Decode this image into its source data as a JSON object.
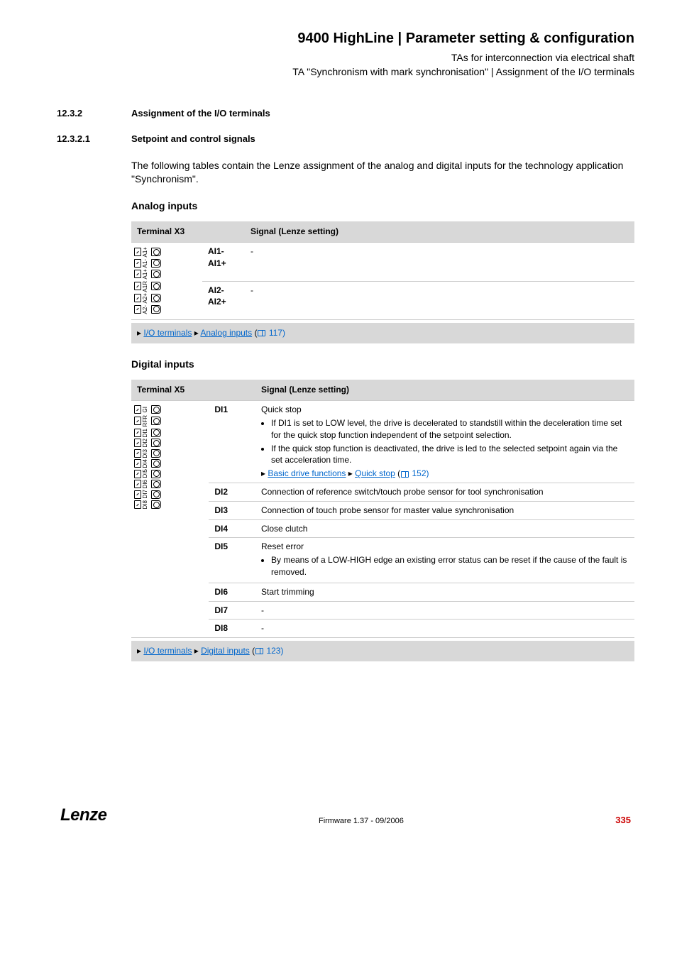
{
  "header": {
    "title": "9400 HighLine | Parameter setting & configuration",
    "sub1": "TAs for interconnection via electrical shaft",
    "sub2": "TA \"Synchronism with mark synchronisation\" | Assignment of the I/O terminals"
  },
  "section1": {
    "num": "12.3.2",
    "title": "Assignment of the I/O terminals"
  },
  "section2": {
    "num": "12.3.2.1",
    "title": "Setpoint and control signals"
  },
  "intro": "The following tables contain the Lenze assignment of the analog and digital inputs for the technology application \"Synchronism\".",
  "analog": {
    "heading": "Analog inputs",
    "col1": "Terminal X3",
    "col2": "Signal (Lenze setting)",
    "rows": [
      {
        "label_a": "AI1-",
        "label_b": "AI1+",
        "signal": "-"
      },
      {
        "label_a": "AI2-",
        "label_b": "AI2+",
        "signal": "-"
      }
    ],
    "pins": [
      "A1+",
      "A1-",
      "A1+",
      "A1R",
      "A2+",
      "A2-"
    ],
    "linkbar": {
      "pre": "▸ ",
      "link1": "I/O terminals",
      "mid": " ▸ ",
      "link2": "Analog inputs",
      "ref": " 117)"
    }
  },
  "digital": {
    "heading": "Digital inputs",
    "col1": "Terminal X5",
    "col2": "Signal (Lenze setting)",
    "pins": [
      "GI",
      "RFR",
      "DI1",
      "DI2",
      "DI3",
      "DI4",
      "DI5",
      "DI6",
      "DI7",
      "DI8"
    ],
    "rows": [
      {
        "label": "DI1",
        "title": "Quick stop",
        "bullets": [
          "If DI1 is set to LOW level, the drive is decelerated to standstill within the deceleration time set for the quick stop function independent of the setpoint selection.",
          "If the quick stop function is deactivated, the drive is led to the selected setpoint again via the set acceleration time."
        ],
        "link": {
          "pre": "▸ ",
          "l1": "Basic drive functions",
          "mid": " ▸ ",
          "l2": "Quick stop",
          "ref": " 152)"
        }
      },
      {
        "label": "DI2",
        "plain": "Connection of reference switch/touch probe sensor for tool synchronisation"
      },
      {
        "label": "DI3",
        "plain": "Connection of touch probe sensor for master value synchronisation"
      },
      {
        "label": "DI4",
        "plain": "Close clutch"
      },
      {
        "label": "DI5",
        "title": "Reset error",
        "bullets": [
          "By means of a LOW-HIGH edge an existing error status can be reset if the cause of the fault is removed."
        ]
      },
      {
        "label": "DI6",
        "plain": "Start trimming"
      },
      {
        "label": "DI7",
        "plain": "-"
      },
      {
        "label": "DI8",
        "plain": "-"
      }
    ],
    "linkbar": {
      "pre": "▸ ",
      "link1": "I/O terminals",
      "mid": " ▸ ",
      "link2": "Digital inputs",
      "ref": " 123)"
    }
  },
  "footer": {
    "logo": "Lenze",
    "fw": "Firmware 1.37 - 09/2006",
    "page": "335"
  }
}
